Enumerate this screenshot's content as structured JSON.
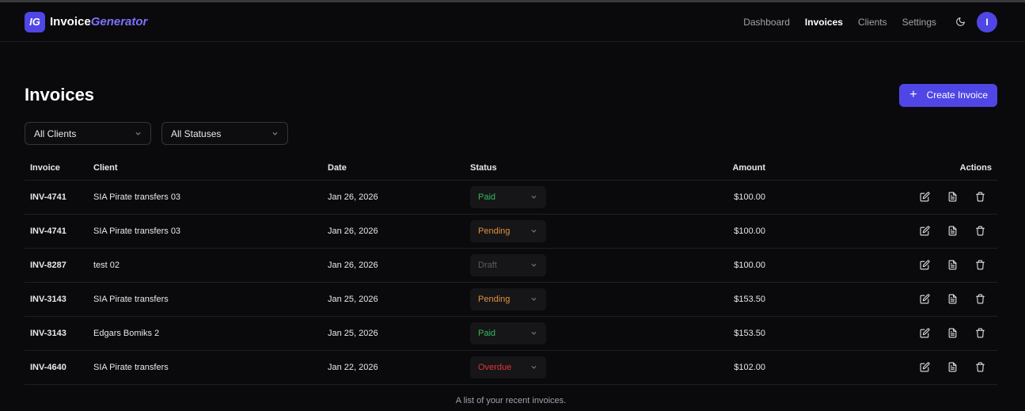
{
  "brand": {
    "badge": "IG",
    "name_a": "Invoice",
    "name_b": "Generator"
  },
  "nav": {
    "links": [
      "Dashboard",
      "Invoices",
      "Clients",
      "Settings"
    ],
    "active": "Invoices",
    "avatar_initial": "I"
  },
  "page": {
    "title": "Invoices",
    "create_label": "Create Invoice"
  },
  "filters": {
    "client": "All Clients",
    "status": "All Statuses"
  },
  "table": {
    "headers": {
      "invoice": "Invoice",
      "client": "Client",
      "date": "Date",
      "status": "Status",
      "amount": "Amount",
      "actions": "Actions"
    },
    "rows": [
      {
        "invoice": "INV-4741",
        "client": "SIA Pirate transfers 03",
        "date": "Jan 26, 2026",
        "status": "Paid",
        "amount": "$100.00"
      },
      {
        "invoice": "INV-4741",
        "client": "SIA Pirate transfers 03",
        "date": "Jan 26, 2026",
        "status": "Pending",
        "amount": "$100.00"
      },
      {
        "invoice": "INV-8287",
        "client": "test 02",
        "date": "Jan 26, 2026",
        "status": "Draft",
        "amount": "$100.00"
      },
      {
        "invoice": "INV-3143",
        "client": "SIA Pirate transfers",
        "date": "Jan 25, 2026",
        "status": "Pending",
        "amount": "$153.50"
      },
      {
        "invoice": "INV-3143",
        "client": "Edgars Bomiks 2",
        "date": "Jan 25, 2026",
        "status": "Paid",
        "amount": "$153.50"
      },
      {
        "invoice": "INV-4640",
        "client": "SIA Pirate transfers",
        "date": "Jan 22, 2026",
        "status": "Overdue",
        "amount": "$102.00"
      }
    ],
    "caption": "A list of your recent invoices."
  },
  "icons": {
    "theme": "moon-icon",
    "create": "plus-icon",
    "dropdown": "chevron-down-icon",
    "edit": "edit-icon",
    "view": "document-icon",
    "delete": "trash-icon"
  },
  "colors": {
    "accent": "#4f46e5",
    "paid": "#33b85a",
    "pending": "#e0913a",
    "draft": "#5c5c63",
    "overdue": "#e23535",
    "background": "#0a0a0c"
  }
}
